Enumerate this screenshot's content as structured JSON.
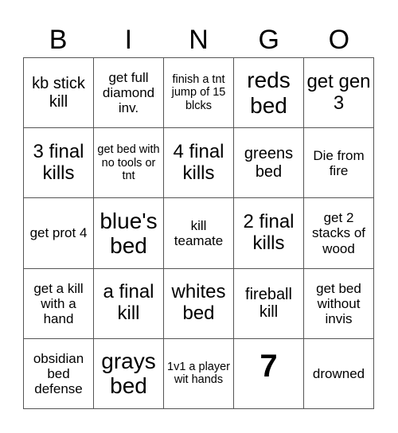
{
  "header": {
    "letters": [
      "B",
      "I",
      "N",
      "G",
      "O"
    ]
  },
  "board": {
    "cells": [
      {
        "text": "kb stick kill",
        "size": "md"
      },
      {
        "text": "get full diamond inv.",
        "size": "sm"
      },
      {
        "text": "finish a tnt jump of 15 blcks",
        "size": "xs"
      },
      {
        "text": "reds bed",
        "size": "xl"
      },
      {
        "text": "get gen 3",
        "size": "lg"
      },
      {
        "text": "3 final kills",
        "size": "lg"
      },
      {
        "text": "get bed with no tools or tnt",
        "size": "xs"
      },
      {
        "text": "4 final kills",
        "size": "lg"
      },
      {
        "text": "greens bed",
        "size": "md"
      },
      {
        "text": "Die from fire",
        "size": "sm"
      },
      {
        "text": "get prot 4",
        "size": "sm"
      },
      {
        "text": "blue's bed",
        "size": "xl"
      },
      {
        "text": "kill teamate",
        "size": "sm"
      },
      {
        "text": "2 final kills",
        "size": "lg"
      },
      {
        "text": "get 2 stacks of wood",
        "size": "sm"
      },
      {
        "text": "get a kill with a hand",
        "size": "sm"
      },
      {
        "text": "a final kill",
        "size": "lg"
      },
      {
        "text": "whites bed",
        "size": "lg"
      },
      {
        "text": "fireball kill",
        "size": "md"
      },
      {
        "text": "get bed without invis",
        "size": "sm"
      },
      {
        "text": "obsidian bed defense",
        "size": "sm"
      },
      {
        "text": "grays bed",
        "size": "xl"
      },
      {
        "text": "1v1 a player wit hands",
        "size": "xs"
      },
      {
        "text": "7",
        "size": "free"
      },
      {
        "text": "drowned",
        "size": "sm"
      }
    ]
  }
}
